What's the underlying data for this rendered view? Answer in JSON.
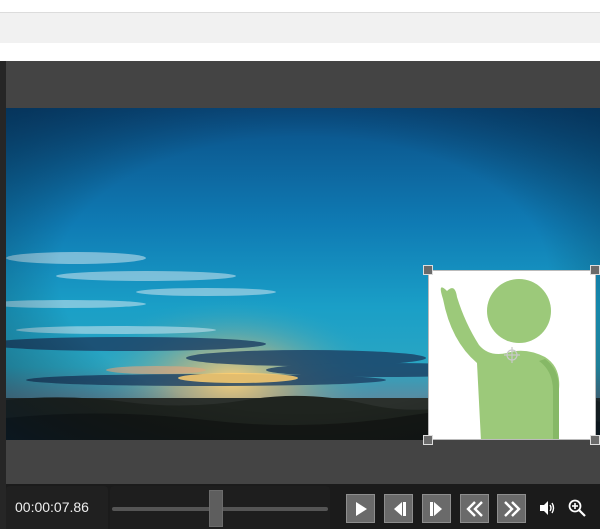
{
  "player": {
    "time": "00:00:07.86",
    "seek_position_fraction": 0.48
  },
  "controls": {
    "icons": [
      "play-icon",
      "step-back-icon",
      "step-forward-icon",
      "rewind-icon",
      "fast-forward-icon",
      "volume-icon",
      "zoom-icon"
    ]
  },
  "colors": {
    "player_background": "#444444",
    "controls_background": "#1b1b1b",
    "button_fill": "#6a6a6a",
    "figure_green": "#9cc97a"
  }
}
